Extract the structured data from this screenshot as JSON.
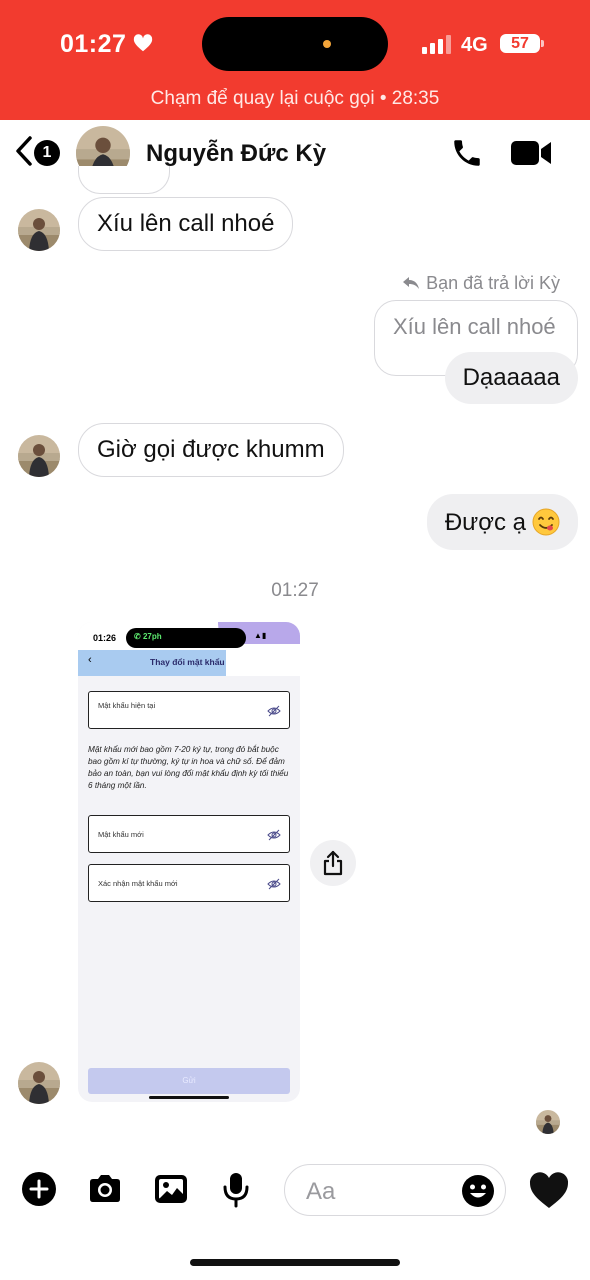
{
  "status_bar": {
    "time": "01:27",
    "network": "4G",
    "battery": "57",
    "call_banner": "Chạm để quay lại cuộc gọi • 28:35"
  },
  "header": {
    "back_badge": "1",
    "contact_name": "Nguyễn Đức Kỳ"
  },
  "messages": [
    {
      "from": "them",
      "text": "Xíu lên call nhoé"
    },
    {
      "from": "me",
      "reply_label": "Bạn đã trả lời Kỳ",
      "quoted": "Xíu lên call nhoé",
      "text": "Dạaaaaa"
    },
    {
      "from": "them",
      "text": "Giờ gọi được khumm"
    },
    {
      "from": "me",
      "text": "Được ạ",
      "emoji": "yum-face-emoji"
    }
  ],
  "timestamp": "01:27",
  "screenshot": {
    "time": "01:26",
    "call_timer": "27ph",
    "title": "Thay đổi mật khẩu",
    "current_password": "Mật khẩu hiện tại",
    "description": "Mật khẩu mới bao gồm 7-20 ký tự, trong đó bắt buộc bao gồm kí tự thường, ký tự in hoa và chữ số. Để đảm bảo an toàn, bạn vui lòng đổi mật khẩu định kỳ tối thiểu 6 tháng một lần.",
    "new_password": "Mật khẩu mới",
    "confirm_password": "Xác nhận mật khẩu mới",
    "submit": "Gửi"
  },
  "composer": {
    "placeholder": "Aa"
  },
  "colors": {
    "call_banner_red": "#f23b2f",
    "bubble_out": "#efeff1",
    "bubble_border": "#d9d9dd",
    "screenshot_accent_blue": "#a9cbf0",
    "screenshot_accent_purple": "#b8a8ea"
  },
  "icons": [
    "heart-icon",
    "signal-icon",
    "back-chevron-icon",
    "phone-icon",
    "video-icon",
    "reply-icon",
    "share-icon",
    "plus-icon",
    "camera-icon",
    "image-icon",
    "microphone-icon",
    "emoji-icon",
    "black-heart-icon"
  ]
}
